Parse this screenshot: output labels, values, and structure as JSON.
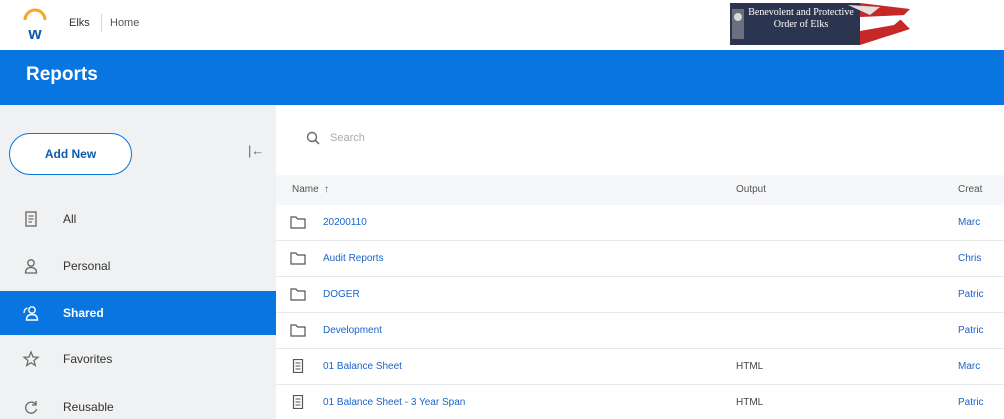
{
  "topbar": {
    "brand": "Elks",
    "breadcrumb": "Home",
    "banner_text": "Benevolent and Protective Order of Elks"
  },
  "header": {
    "title": "Reports"
  },
  "sidebar": {
    "add_new_label": "Add New",
    "collapse_glyph": "|←",
    "items": [
      {
        "label": "All",
        "icon": "document-icon",
        "active": false
      },
      {
        "label": "Personal",
        "icon": "person-icon",
        "active": false
      },
      {
        "label": "Shared",
        "icon": "shared-person-icon",
        "active": true
      },
      {
        "label": "Favorites",
        "icon": "star-icon",
        "active": false
      },
      {
        "label": "Reusable",
        "icon": "refresh-icon",
        "active": false
      }
    ]
  },
  "main": {
    "search_placeholder": "Search",
    "columns": {
      "name": "Name",
      "sort_glyph": "↑",
      "output": "Output",
      "creator": "Creat"
    },
    "rows": [
      {
        "name": "20200110",
        "output": "",
        "creator": "Marc",
        "icon": "folder-icon"
      },
      {
        "name": "Audit Reports",
        "output": "",
        "creator": "Chris",
        "icon": "folder-icon"
      },
      {
        "name": "DOGER",
        "output": "",
        "creator": "Patric",
        "icon": "folder-icon"
      },
      {
        "name": "Development",
        "output": "",
        "creator": "Patric",
        "icon": "folder-icon"
      },
      {
        "name": "01 Balance Sheet",
        "output": "HTML",
        "creator": "Marc",
        "icon": "report-icon"
      },
      {
        "name": "01 Balance Sheet - 3 Year Span",
        "output": "HTML",
        "creator": "Patric",
        "icon": "report-icon"
      }
    ]
  },
  "colors": {
    "brand_blue": "#0875e1",
    "link_blue": "#1a64c8",
    "sidebar_bg": "#f0f1f2"
  }
}
